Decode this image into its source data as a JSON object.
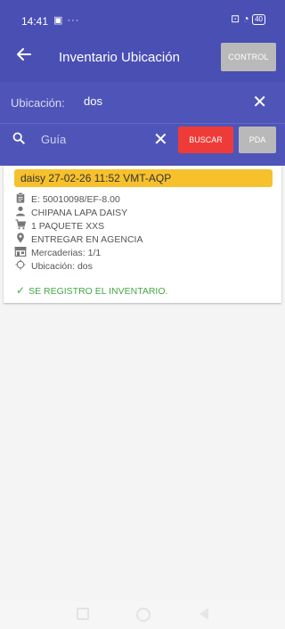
{
  "status_bar": {
    "time": "14:41",
    "left_icons": "▣ ···",
    "right_icons": "⊡ ◔",
    "battery": "40"
  },
  "header": {
    "title": "Inventario Ubicación",
    "control_label": "CONTROL"
  },
  "location_field": {
    "label": "Ubicación:",
    "value": "dos",
    "clear_glyph": "✕"
  },
  "search": {
    "placeholder": "Guía",
    "clear_glyph": "✕",
    "buscar_label": "BUSCAR",
    "pda_label": "PDA"
  },
  "card": {
    "header": "daisy  27-02-26 11:52 VMT-AQP",
    "code": "E: 50010098/EF-8.00",
    "recipient": "CHIPANA LAPA DAISY",
    "package": "1 PAQUETE XXS",
    "delivery": "ENTREGAR EN AGENCIA",
    "merchandise": "Mercaderias: 1/1",
    "location": "Ubicación: dos",
    "success_message": "SE REGISTRO EL INVENTARIO."
  },
  "colors": {
    "primary": "#4a4fb4",
    "panel": "#4f55b8",
    "buscar": "#ee3b38",
    "gray_button": "#b9b9b9",
    "card_header": "#f6c12d",
    "success": "#45a845"
  },
  "icons": {
    "back": "arrow-left",
    "search": "magnifier",
    "clear": "close-x",
    "code": "clipboard",
    "recipient": "person",
    "package": "cart",
    "delivery": "map-pin",
    "merchandise": "storefront",
    "location": "target",
    "success": "check"
  }
}
